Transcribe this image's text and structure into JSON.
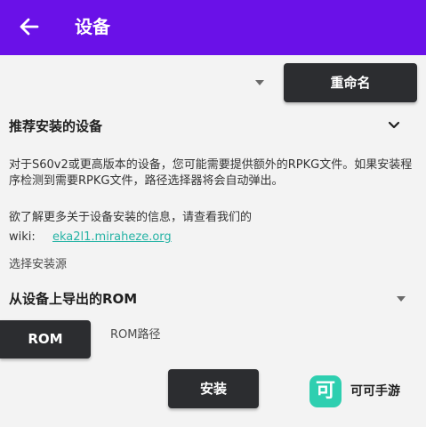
{
  "app_bar": {
    "title": "设备",
    "back_icon": "arrow-left-icon",
    "color": "#6a11e8"
  },
  "device": {
    "selected_device": "",
    "rename_label": "重命名"
  },
  "recommended": {
    "title": "推荐安装的设备",
    "expanded": true,
    "description": "对于S60v2或更高版本的设备，您可能需要提供额外的RPKG文件。如果安装程序检测到需要RPKG文件，路径选择器将会自动弹出。",
    "more_info": "欲了解更多关于设备安装的信息，请查看我们的",
    "wiki_label": "wiki:",
    "wiki_link": "eka2l1.miraheze.org"
  },
  "install_source": {
    "label": "选择安装源",
    "selected": "从设备上导出的ROM",
    "rom_button_label": "ROM",
    "rom_path_label": "ROM路径"
  },
  "actions": {
    "install_label": "安装"
  },
  "watermark": {
    "logo_char": "可",
    "text": "可可手游",
    "logo_color": "#2ecfb0"
  }
}
